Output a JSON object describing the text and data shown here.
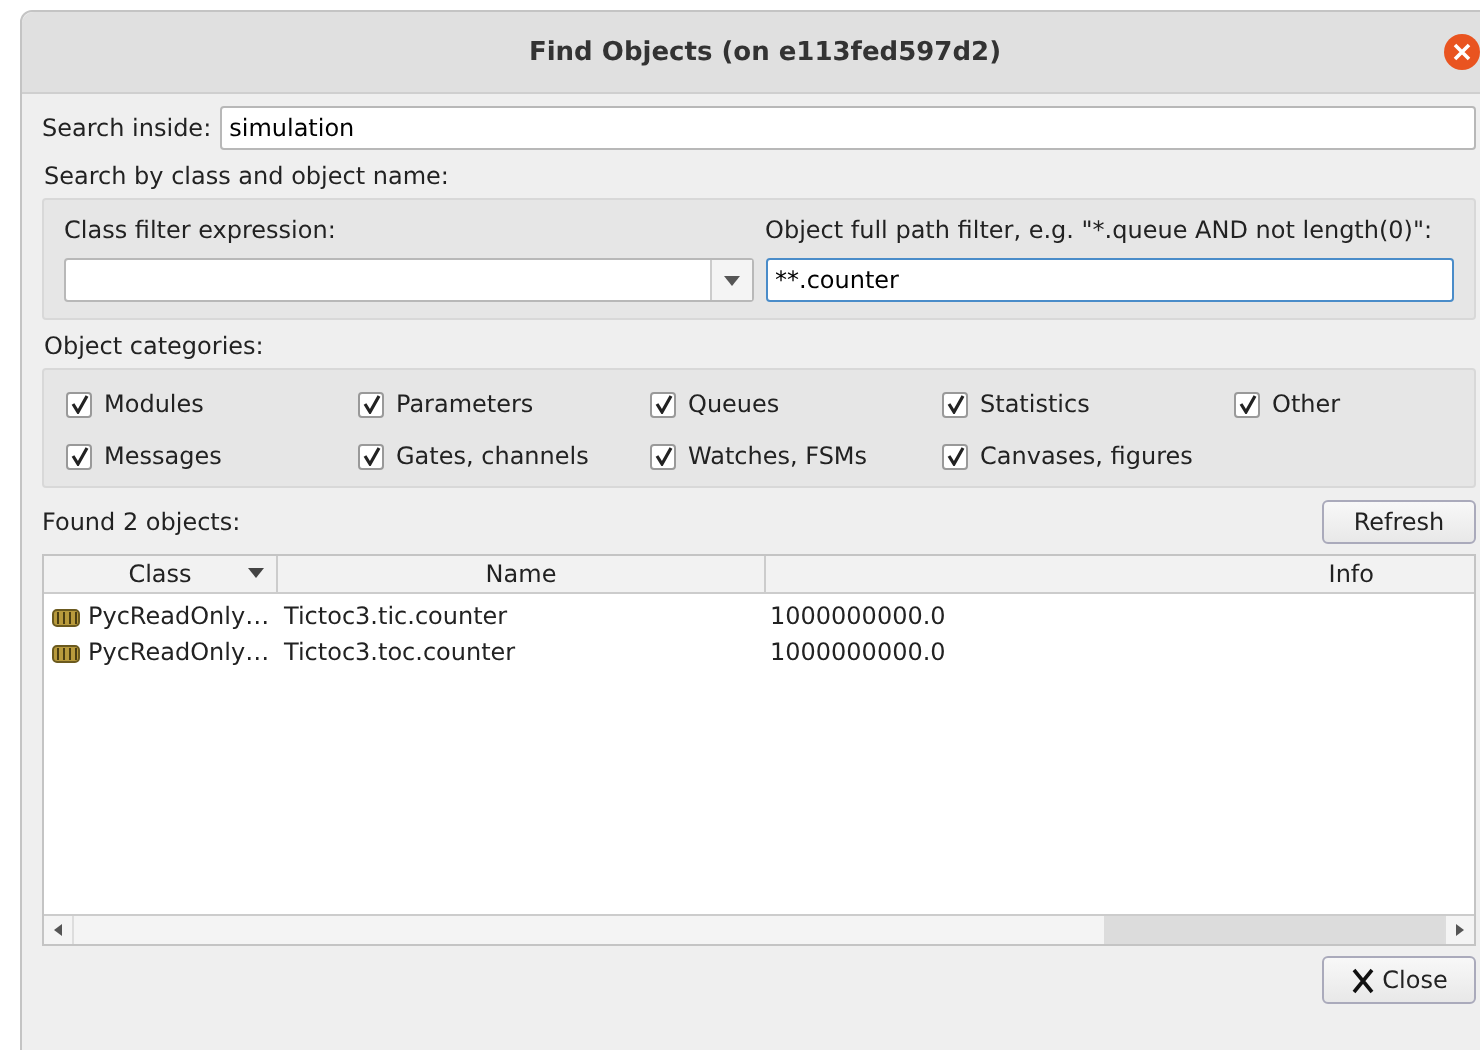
{
  "window": {
    "title": "Find Objects (on e113fed597d2)"
  },
  "search_inside": {
    "label": "Search inside:",
    "value": "simulation"
  },
  "filter_group": {
    "label": "Search by class and object name:",
    "class_filter": {
      "label": "Class filter expression:"
    },
    "path_filter": {
      "label": "Object full path filter, e.g. \"*.queue AND not length(0)\":",
      "value": "**.counter"
    }
  },
  "categories": {
    "label": "Object categories:",
    "items": [
      {
        "label": "Modules",
        "checked": true
      },
      {
        "label": "Parameters",
        "checked": true
      },
      {
        "label": "Queues",
        "checked": true
      },
      {
        "label": "Statistics",
        "checked": true
      },
      {
        "label": "Other",
        "checked": true
      },
      {
        "label": "Messages",
        "checked": true
      },
      {
        "label": "Gates, channels",
        "checked": true
      },
      {
        "label": "Watches, FSMs",
        "checked": true
      },
      {
        "label": "Canvases, figures",
        "checked": true
      }
    ]
  },
  "results": {
    "label": "Found 2 objects:",
    "refresh_button": "Refresh",
    "columns": [
      "Class",
      "Name",
      "Info"
    ],
    "rows": [
      {
        "class": "PycReadOnly…",
        "name": "Tictoc3.tic.counter",
        "value": "1000000000.0"
      },
      {
        "class": "PycReadOnly…",
        "name": "Tictoc3.toc.counter",
        "value": "1000000000.0"
      }
    ]
  },
  "close_button": "Close"
}
